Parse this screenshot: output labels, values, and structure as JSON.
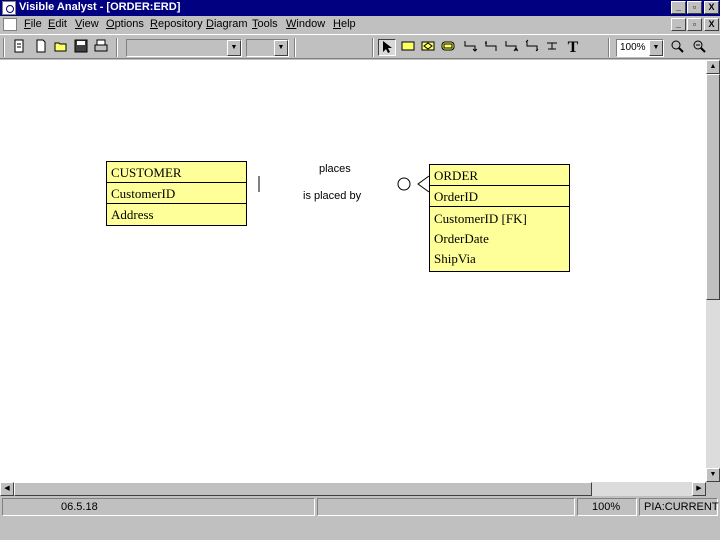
{
  "window": {
    "title": "Visible Analyst - [ORDER:ERD]",
    "controls": [
      "_",
      "▫",
      "X"
    ],
    "child_controls": [
      "_",
      "▫",
      "X"
    ]
  },
  "menu": [
    "File",
    "Edit",
    "View",
    "Options",
    "Repository",
    "Diagram",
    "Tools",
    "Window",
    "Help"
  ],
  "toolbar": {
    "zoom_value": "100%",
    "file_icons": [
      "new-file-icon",
      "new-doc-icon",
      "open-icon",
      "save-icon",
      "print-icon"
    ],
    "draw_tools": [
      "pointer-icon",
      "entity-tool-icon",
      "associative-entity-icon",
      "attributive-entity-icon",
      "relationship-tool-icon",
      "relationship-tool-2-icon",
      "relationship-tool-3-icon",
      "relationship-tool-4-icon",
      "relationship-tool-5-icon",
      "text-tool-icon"
    ],
    "text_tool_label": "T",
    "zoom_icons": [
      "zoom-in-icon",
      "zoom-out-icon"
    ]
  },
  "diagram": {
    "entities": [
      {
        "id": "customer",
        "name": "CUSTOMER",
        "keys": [
          "CustomerID"
        ],
        "attributes": [
          "Address"
        ]
      },
      {
        "id": "order",
        "name": "ORDER",
        "keys": [
          "OrderID"
        ],
        "attributes": [
          "CustomerID [FK]",
          "OrderDate",
          "ShipVia"
        ]
      }
    ],
    "relationship": {
      "forward_label": "places",
      "reverse_label": "is placed by",
      "from": "CUSTOMER",
      "to": "ORDER",
      "from_cardinality": "exactly one",
      "to_cardinality": "zero or many"
    }
  },
  "status": {
    "version": "06.5.18",
    "zoom": "100%",
    "mode": "PIA:CURRENT"
  }
}
